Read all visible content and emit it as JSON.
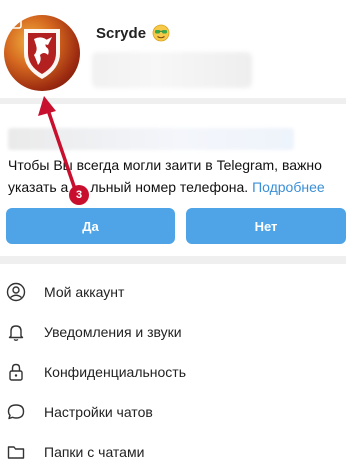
{
  "profile": {
    "name": "Scryde",
    "emoji": "smiling-face-with-sunglasses"
  },
  "notice": {
    "text_line1": "Чтобы Вы всегда могли заити в Telegram, важно",
    "text_line2_start": "указать а",
    "text_line2_mid": "льный номер телефона.",
    "more_link": "Подробнее",
    "yes_button": "Да",
    "no_button": "Нет"
  },
  "menu": {
    "items": [
      {
        "label": "Мой аккаунт",
        "icon": "account-icon"
      },
      {
        "label": "Уведомления и звуки",
        "icon": "bell-icon"
      },
      {
        "label": "Конфиденциальность",
        "icon": "lock-icon"
      },
      {
        "label": "Настройки чатов",
        "icon": "chat-bubble-icon"
      },
      {
        "label": "Папки с чатами",
        "icon": "folder-icon"
      }
    ]
  },
  "annotation": {
    "step_number": "3",
    "color": "#c8102e"
  },
  "colors": {
    "accent": "#4ea4e6",
    "link": "#3a8fd6",
    "divider": "#efefef"
  }
}
